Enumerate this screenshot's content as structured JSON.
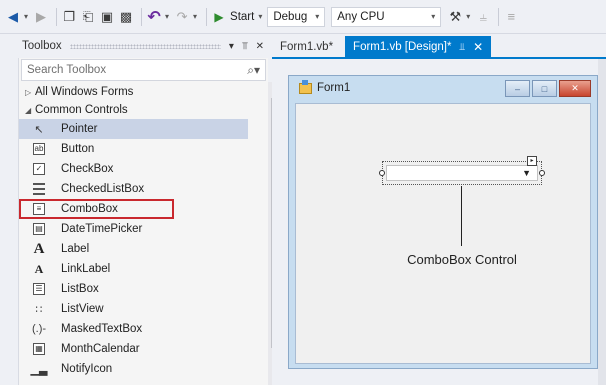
{
  "toolbar": {
    "start_label": "Start",
    "config_value": "Debug",
    "platform_value": "Any CPU"
  },
  "toolbox": {
    "title": "Toolbox",
    "search_placeholder": "Search Toolbox",
    "groups": [
      {
        "label": "All Windows Forms",
        "expanded": false
      },
      {
        "label": "Common Controls",
        "expanded": true
      }
    ],
    "items": [
      {
        "label": "Pointer",
        "icon": "pointer-icon",
        "selected": true
      },
      {
        "label": "Button",
        "icon": "button-icon"
      },
      {
        "label": "CheckBox",
        "icon": "checkbox-icon"
      },
      {
        "label": "CheckedListBox",
        "icon": "checkedlistbox-icon"
      },
      {
        "label": "ComboBox",
        "icon": "combobox-icon",
        "highlighted": true
      },
      {
        "label": "DateTimePicker",
        "icon": "datetimepicker-icon"
      },
      {
        "label": "Label",
        "icon": "label-icon"
      },
      {
        "label": "LinkLabel",
        "icon": "linklabel-icon"
      },
      {
        "label": "ListBox",
        "icon": "listbox-icon"
      },
      {
        "label": "ListView",
        "icon": "listview-icon"
      },
      {
        "label": "MaskedTextBox",
        "icon": "maskedtextbox-icon"
      },
      {
        "label": "MonthCalendar",
        "icon": "monthcalendar-icon"
      },
      {
        "label": "NotifyIcon",
        "icon": "notifyicon-icon"
      }
    ]
  },
  "tabs": [
    {
      "label": "Form1.vb*",
      "active": false
    },
    {
      "label": "Form1.vb [Design]*",
      "active": true
    }
  ],
  "form": {
    "title": "Form1"
  },
  "annotation": {
    "text": "ComboBox Control"
  },
  "colors": {
    "accent": "#007acc",
    "highlight_border": "#c9282e",
    "selected_item": "#c9d3e6"
  }
}
